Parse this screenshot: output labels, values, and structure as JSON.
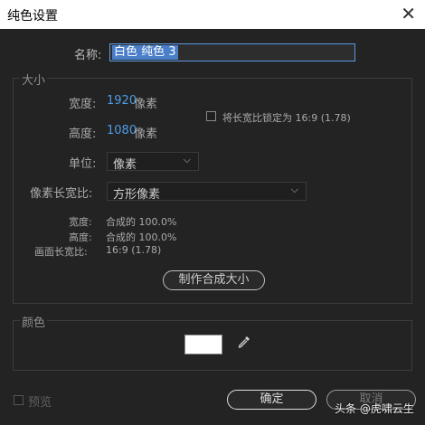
{
  "title": "纯色设置",
  "close_icon": "close-icon",
  "name": {
    "label": "名称:",
    "value": "白色 纯色 3"
  },
  "size": {
    "legend": "大小",
    "width_label": "宽度:",
    "width_value": "1920",
    "height_label": "高度:",
    "height_value": "1080",
    "pixel_unit": "像素",
    "lock_label": "将长宽比锁定为 16:9 (1.78)",
    "unit_label": "单位:",
    "unit_value": "像素",
    "pixel_aspect_label": "像素长宽比:",
    "pixel_aspect_value": "方形像素",
    "info_width_label": "宽度:",
    "info_width_value": "合成的 100.0%",
    "info_height_label": "高度:",
    "info_height_value": "合成的 100.0%",
    "frame_aspect_label": "画面长宽比:",
    "frame_aspect_value": "16:9 (1.78)",
    "make_comp_size": "制作合成大小"
  },
  "color": {
    "legend": "颜色",
    "swatch": "#ffffff",
    "dropper_icon": "eyedropper-icon"
  },
  "footer": {
    "preview_label": "预览",
    "ok": "确定",
    "cancel": "取消"
  },
  "watermark": "头条 @虎啸云生"
}
